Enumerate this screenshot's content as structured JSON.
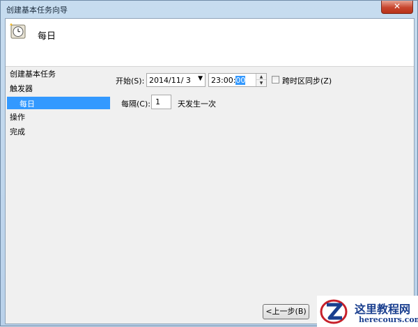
{
  "window": {
    "title": "创建基本任务向导",
    "close_glyph": "✕"
  },
  "header": {
    "heading": "每日",
    "icon": "clock-icon"
  },
  "steps": [
    {
      "label": "创建基本任务",
      "selected": false
    },
    {
      "label": "触发器",
      "selected": false
    },
    {
      "label": "每日",
      "selected": true
    },
    {
      "label": "操作",
      "selected": false
    },
    {
      "label": "完成",
      "selected": false
    }
  ],
  "form": {
    "start_label": "开始(S):",
    "start_date": "2014/11/  3",
    "start_time_prefix": "23:00:",
    "start_time_selected": "00",
    "sync_label": "跨时区同步(Z)",
    "sync_checked": false,
    "interval_label": "每隔(C):",
    "interval_value": "1",
    "interval_suffix": "天发生一次"
  },
  "buttons": {
    "back": "<上一步(B)"
  },
  "watermark": {
    "cn": "这里教程网",
    "en": "herecours.com"
  },
  "colors": {
    "selection": "#3399ff",
    "close": "#c7452d"
  }
}
